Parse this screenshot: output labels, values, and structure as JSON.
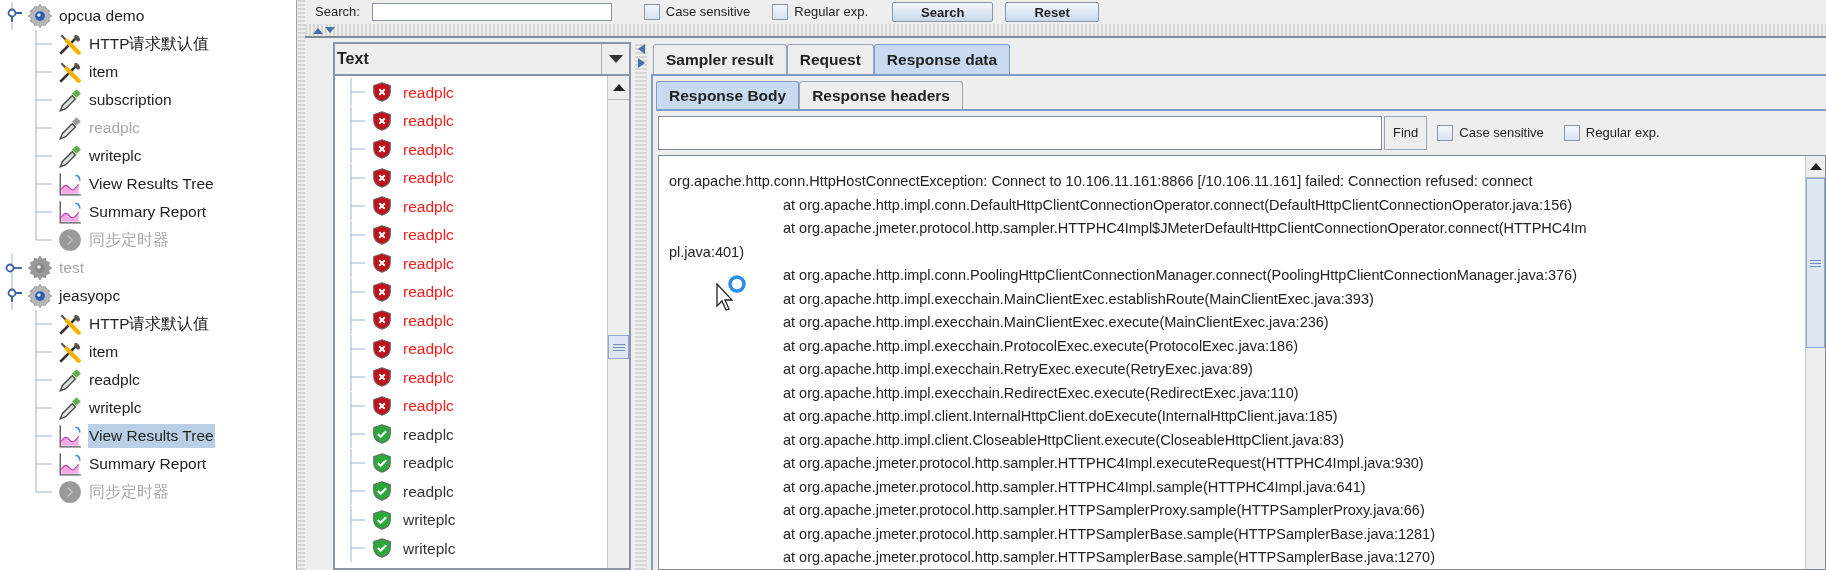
{
  "tree": [
    {
      "label": "opcua demo",
      "kind": "thread_group",
      "disabled": false,
      "expanded": true,
      "selected": false,
      "children": [
        {
          "label": "HTTP请求默认值",
          "kind": "config",
          "disabled": false,
          "selected": false
        },
        {
          "label": "item",
          "kind": "config",
          "disabled": false,
          "selected": false
        },
        {
          "label": "subscription",
          "kind": "sampler",
          "disabled": false,
          "selected": false
        },
        {
          "label": "readplc",
          "kind": "sampler",
          "disabled": true,
          "selected": false
        },
        {
          "label": "writeplc",
          "kind": "sampler",
          "disabled": false,
          "selected": false
        },
        {
          "label": "View Results Tree",
          "kind": "listener",
          "disabled": false,
          "selected": false
        },
        {
          "label": "Summary Report",
          "kind": "listener",
          "disabled": false,
          "selected": false
        },
        {
          "label": "同步定时器",
          "kind": "timer",
          "disabled": true,
          "selected": false
        }
      ]
    },
    {
      "label": "test",
      "kind": "thread_group",
      "disabled": true,
      "expanded": false,
      "selected": false
    },
    {
      "label": "jeasyopc",
      "kind": "thread_group",
      "disabled": false,
      "expanded": true,
      "selected": false,
      "children": [
        {
          "label": "HTTP请求默认值",
          "kind": "config",
          "disabled": false,
          "selected": false
        },
        {
          "label": "item",
          "kind": "config",
          "disabled": false,
          "selected": false
        },
        {
          "label": "readplc",
          "kind": "sampler",
          "disabled": false,
          "selected": false
        },
        {
          "label": "writeplc",
          "kind": "sampler",
          "disabled": false,
          "selected": false
        },
        {
          "label": "View Results Tree",
          "kind": "listener",
          "disabled": false,
          "selected": true
        },
        {
          "label": "Summary Report",
          "kind": "listener",
          "disabled": false,
          "selected": false
        },
        {
          "label": "同步定时器",
          "kind": "timer",
          "disabled": true,
          "selected": false
        }
      ]
    }
  ],
  "search_bar": {
    "label": "Search:",
    "case_sensitive": {
      "label": "Case sensitive",
      "checked": false
    },
    "regular_exp": {
      "label": "Regular exp.",
      "checked": false
    },
    "buttons": [
      "Search",
      "Reset"
    ]
  },
  "results": {
    "renderer": "Text",
    "items": [
      {
        "label": "readplc",
        "success": false
      },
      {
        "label": "readplc",
        "success": false
      },
      {
        "label": "readplc",
        "success": false
      },
      {
        "label": "readplc",
        "success": false
      },
      {
        "label": "readplc",
        "success": false
      },
      {
        "label": "readplc",
        "success": false
      },
      {
        "label": "readplc",
        "success": false
      },
      {
        "label": "readplc",
        "success": false
      },
      {
        "label": "readplc",
        "success": false
      },
      {
        "label": "readplc",
        "success": false
      },
      {
        "label": "readplc",
        "success": false
      },
      {
        "label": "readplc",
        "success": false
      },
      {
        "label": "readplc",
        "success": true
      },
      {
        "label": "readplc",
        "success": true
      },
      {
        "label": "readplc",
        "success": true
      },
      {
        "label": "writeplc",
        "success": true
      },
      {
        "label": "writeplc",
        "success": true
      }
    ]
  },
  "tabs": [
    {
      "label": "Sampler result",
      "selected": false
    },
    {
      "label": "Request",
      "selected": false
    },
    {
      "label": "Response data",
      "selected": true
    }
  ],
  "sub_tabs": [
    {
      "label": "Response Body",
      "selected": true
    },
    {
      "label": "Response headers",
      "selected": false
    }
  ],
  "find_bar": {
    "button": "Find",
    "case_sensitive": {
      "label": "Case sensitive",
      "checked": false
    },
    "regular_exp": {
      "label": "Regular exp.",
      "checked": false
    }
  },
  "response_lines": [
    {
      "kind": "head",
      "text": "org.apache.http.conn.HttpHostConnectException: Connect to 10.106.11.161:8866 [/10.106.11.161] failed: Connection refused: connect"
    },
    {
      "kind": "at",
      "text": "at org.apache.http.impl.conn.DefaultHttpClientConnectionOperator.connect(DefaultHttpClientConnectionOperator.java:156)"
    },
    {
      "kind": "at",
      "text": "at org.apache.jmeter.protocol.http.sampler.HTTPHC4Impl$JMeterDefaultHttpClientConnectionOperator.connect(HTTPHC4Im"
    },
    {
      "kind": "cont",
      "text": "pl.java:401)"
    },
    {
      "kind": "at",
      "text": "at org.apache.http.impl.conn.PoolingHttpClientConnectionManager.connect(PoolingHttpClientConnectionManager.java:376)"
    },
    {
      "kind": "at",
      "text": "at org.apache.http.impl.execchain.MainClientExec.establishRoute(MainClientExec.java:393)"
    },
    {
      "kind": "at",
      "text": "at org.apache.http.impl.execchain.MainClientExec.execute(MainClientExec.java:236)"
    },
    {
      "kind": "at",
      "text": "at org.apache.http.impl.execchain.ProtocolExec.execute(ProtocolExec.java:186)"
    },
    {
      "kind": "at",
      "text": "at org.apache.http.impl.execchain.RetryExec.execute(RetryExec.java:89)"
    },
    {
      "kind": "at",
      "text": "at org.apache.http.impl.execchain.RedirectExec.execute(RedirectExec.java:110)"
    },
    {
      "kind": "at",
      "text": "at org.apache.http.impl.client.InternalHttpClient.doExecute(InternalHttpClient.java:185)"
    },
    {
      "kind": "at",
      "text": "at org.apache.http.impl.client.CloseableHttpClient.execute(CloseableHttpClient.java:83)"
    },
    {
      "kind": "at",
      "text": "at org.apache.jmeter.protocol.http.sampler.HTTPHC4Impl.executeRequest(HTTPHC4Impl.java:930)"
    },
    {
      "kind": "at",
      "text": "at org.apache.jmeter.protocol.http.sampler.HTTPHC4Impl.sample(HTTPHC4Impl.java:641)"
    },
    {
      "kind": "at",
      "text": "at org.apache.jmeter.protocol.http.sampler.HTTPSamplerProxy.sample(HTTPSamplerProxy.java:66)"
    },
    {
      "kind": "at",
      "text": "at org.apache.jmeter.protocol.http.sampler.HTTPSamplerBase.sample(HTTPSamplerBase.java:1281)"
    },
    {
      "kind": "at",
      "text": "at org.apache.jmeter.protocol.http.sampler.HTTPSamplerBase.sample(HTTPSamplerBase.java:1270)"
    }
  ]
}
